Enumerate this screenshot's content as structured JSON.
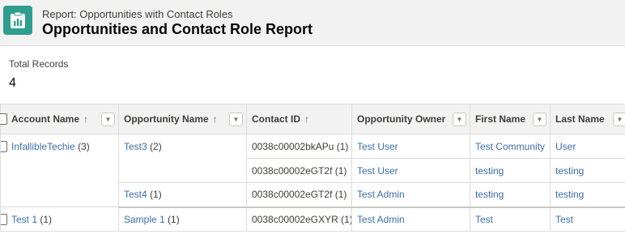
{
  "header": {
    "eyebrow": "Report: Opportunities with Contact Roles",
    "title": "Opportunities and Contact Role Report",
    "icon": "report-icon"
  },
  "summary": {
    "total_label": "Total Records",
    "total_value": "4"
  },
  "table": {
    "columns": [
      {
        "label": "Account Name",
        "sort": "↑"
      },
      {
        "label": "Opportunity Name",
        "sort": "↑"
      },
      {
        "label": "Contact ID",
        "sort": "↑"
      },
      {
        "label": "Opportunity Owner",
        "sort": ""
      },
      {
        "label": "First Name",
        "sort": ""
      },
      {
        "label": "Last Name",
        "sort": ""
      }
    ],
    "menu_glyph": "▼",
    "groups": [
      {
        "account": "InfallibleTechie",
        "account_count": "(3)",
        "opportunities": [
          {
            "name": "Test3",
            "count": "(2)",
            "rows": [
              {
                "contact": "0038c00002bkAPu",
                "contact_count": "(1)",
                "owner": "Test User",
                "first": "Test Community",
                "last": "User"
              },
              {
                "contact": "0038c00002eGT2f",
                "contact_count": "(1)",
                "owner": "Test User",
                "first": "testing",
                "last": "testing"
              }
            ]
          },
          {
            "name": "Test4",
            "count": "(1)",
            "rows": [
              {
                "contact": "0038c00002eGT2f",
                "contact_count": "(1)",
                "owner": "Test Admin",
                "first": "testing",
                "last": "testing"
              }
            ]
          }
        ]
      },
      {
        "account": "Test 1",
        "account_count": "(1)",
        "opportunities": [
          {
            "name": "Sample 1",
            "count": "(1)",
            "rows": [
              {
                "contact": "0038c00002eGXYR",
                "contact_count": "(1)",
                "owner": "Test Admin",
                "first": "Test",
                "last": "Test"
              }
            ]
          }
        ]
      }
    ]
  },
  "colors": {
    "accent": "#2e9e8e",
    "link": "#3b6fa8",
    "header_bg": "#f3f2f2",
    "border": "#dddbda"
  }
}
